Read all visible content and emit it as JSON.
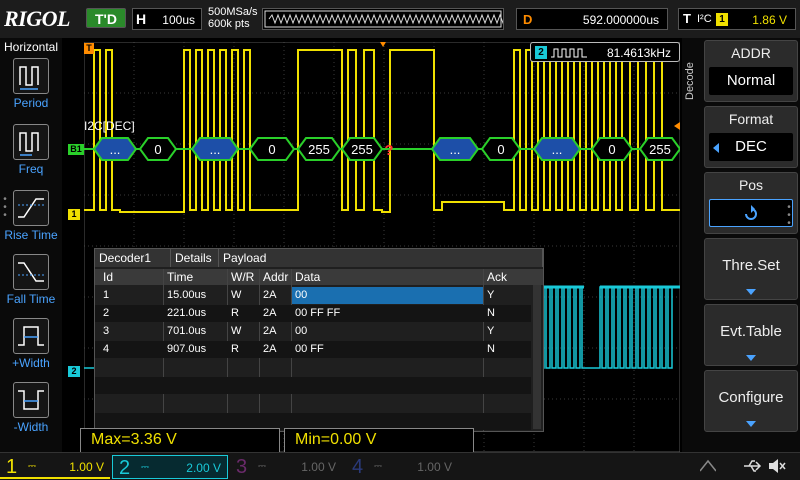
{
  "brand": "RIGOL",
  "top": {
    "trigger_status": "T'D",
    "horizontal_key": "H",
    "timebase": "100us",
    "sample_rate": "500MSa/s",
    "memory_depth": "600k pts",
    "delay_key": "D",
    "delay": "592.000000us",
    "trigger_key": "T",
    "trigger_type": "I²C",
    "trigger_source": "1",
    "trigger_level": "1.86 V"
  },
  "left": {
    "title": "Horizontal",
    "items": [
      {
        "label": "Period"
      },
      {
        "label": "Freq"
      },
      {
        "label": "Rise Time"
      },
      {
        "label": "Fall Time"
      },
      {
        "label": "+Width"
      },
      {
        "label": "-Width"
      }
    ]
  },
  "right": {
    "menu_title": "Decode",
    "items": [
      {
        "title": "ADDR",
        "value": "Normal"
      },
      {
        "title": "Format",
        "value": "DEC"
      },
      {
        "title": "Pos",
        "value": ""
      },
      {
        "title": "Thre.Set"
      },
      {
        "title": "Evt.Table"
      },
      {
        "title": "Configure"
      }
    ]
  },
  "waveform": {
    "protocol_label": "I2C[DEC]",
    "frequency": "81.4613kHz",
    "bus_values": [
      "...",
      "0",
      "...",
      "0",
      "255",
      "255",
      "?",
      "...",
      "0",
      "...",
      "0",
      "255"
    ],
    "markers": {
      "trigger": "T",
      "bus": "B1",
      "ch1": "1",
      "ch2": "2"
    }
  },
  "decoder": {
    "tabs": [
      "Decoder1",
      "Details",
      "Payload"
    ],
    "columns": [
      "Id",
      "Time",
      "W/R",
      "Addr",
      "Data",
      "Ack"
    ],
    "rows": [
      {
        "id": "1",
        "time": "15.00us",
        "wr": "W",
        "addr": "2A",
        "data": "00",
        "ack": "Y"
      },
      {
        "id": "2",
        "time": "221.0us",
        "wr": "R",
        "addr": "2A",
        "data": "00 FF FF",
        "ack": "N"
      },
      {
        "id": "3",
        "time": "701.0us",
        "wr": "W",
        "addr": "2A",
        "data": "00",
        "ack": "Y"
      },
      {
        "id": "4",
        "time": "907.0us",
        "wr": "R",
        "addr": "2A",
        "data": "00 FF",
        "ack": "N"
      }
    ]
  },
  "measurements": {
    "max": "Max=3.36 V",
    "min": "Min=0.00 V"
  },
  "channels": [
    {
      "num": "1",
      "coupling": "⎓",
      "scale": "1.00 V",
      "color": "#f0e000",
      "active": true
    },
    {
      "num": "2",
      "coupling": "⎓",
      "scale": "2.00 V",
      "color": "#19c9d8",
      "active": true
    },
    {
      "num": "3",
      "coupling": "⎓",
      "scale": "1.00 V",
      "color": "#c03cc0",
      "active": false
    },
    {
      "num": "4",
      "coupling": "⎓",
      "scale": "1.00 V",
      "color": "#3c6cff",
      "active": false
    }
  ],
  "colors": {
    "ch1": "#f0e000",
    "ch2": "#19c9d8",
    "bus": "#2ad02a",
    "accent": "#4aa3ff",
    "trigger": "#ff8c00"
  }
}
